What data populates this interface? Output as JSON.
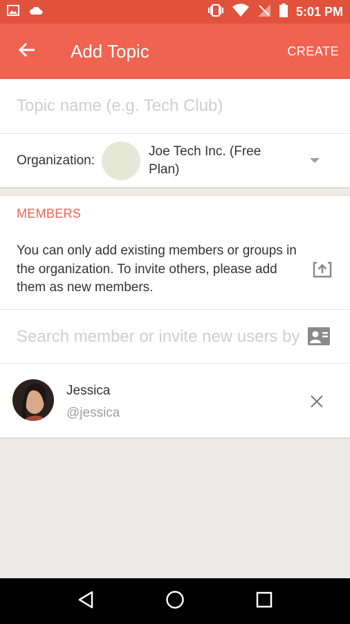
{
  "status_bar": {
    "time": "5:01 PM",
    "icons": [
      "image-icon",
      "cloud-icon",
      "vibrate-icon",
      "wifi-icon",
      "no-signal-icon",
      "battery-icon"
    ]
  },
  "app_bar": {
    "title": "Add Topic",
    "create_label": "CREATE",
    "back_icon": "arrow-back-icon",
    "color": "#f06350"
  },
  "topic": {
    "placeholder": "Topic name (e.g. Tech Club)",
    "value": ""
  },
  "organization": {
    "label": "Organization:",
    "name": "Joe Tech Inc. (Free Plan)",
    "dropdown_icon": "dropdown-arrow-icon"
  },
  "members": {
    "title": "MEMBERS",
    "info": "You can only add existing members or groups in the organization. To invite others, please add them as new members.",
    "search_placeholder": "Search member or invite new users by email",
    "list": [
      {
        "name": "Jessica",
        "handle": "@jessica"
      }
    ]
  },
  "nav": {
    "buttons": [
      "back-triangle-icon",
      "home-circle-icon",
      "recents-square-icon"
    ]
  },
  "colors": {
    "accent": "#f06350",
    "status_bar": "#e1523c",
    "background": "#ecebea"
  }
}
